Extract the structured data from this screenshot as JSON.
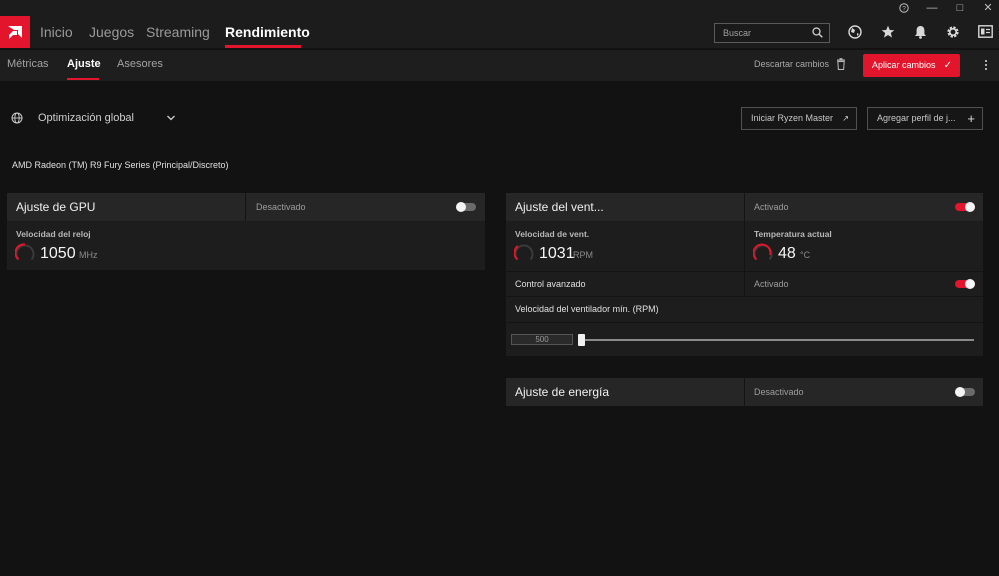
{
  "window": {
    "help_glyph": "?",
    "minimize_glyph": "—",
    "maximize_glyph": "□",
    "close_glyph": "✕"
  },
  "nav": {
    "items": [
      {
        "label": "Inicio"
      },
      {
        "label": "Juegos"
      },
      {
        "label": "Streaming"
      },
      {
        "label": "Rendimiento"
      }
    ],
    "active_index": 3
  },
  "search": {
    "placeholder": "Buscar"
  },
  "top_icons": [
    "globe-icon",
    "star-icon",
    "bell-icon",
    "gear-icon",
    "layout-icon"
  ],
  "subnav": {
    "items": [
      {
        "label": "Métricas"
      },
      {
        "label": "Ajuste"
      },
      {
        "label": "Asesores"
      }
    ],
    "active_index": 1
  },
  "actions": {
    "discard_label": "Descartar cambios",
    "apply_label": "Aplicar cambios"
  },
  "profile": {
    "selected": "Optimización global",
    "ryzen_master_label": "Iniciar Ryzen Master",
    "add_profile_label": "Agregar perfil de j..."
  },
  "device": {
    "name": "AMD Radeon (TM) R9 Fury Series (Principal/Discreto)"
  },
  "gpu_tuning": {
    "title": "Ajuste de GPU",
    "state": "Desactivado",
    "enabled": false,
    "clock_label": "Velocidad del reloj",
    "clock_value": "1050",
    "clock_unit": "MHz"
  },
  "fan_tuning": {
    "title": "Ajuste del vent...",
    "state": "Activado",
    "enabled": true,
    "fan_speed_label": "Velocidad de vent.",
    "fan_speed_value": "1031",
    "fan_speed_unit": "RPM",
    "temp_label": "Temperatura actual",
    "temp_value": "48",
    "temp_unit": "°C",
    "advanced_label": "Control avanzado",
    "advanced_state": "Activado",
    "advanced_enabled": true,
    "min_speed_label": "Velocidad del ventilador mín. (RPM)",
    "min_speed_value": "500",
    "min_speed_fraction": 0.0
  },
  "power_tuning": {
    "title": "Ajuste de energía",
    "state": "Desactivado",
    "enabled": false
  },
  "colors": {
    "accent": "#e2152c",
    "background": "#121212",
    "card": "#1d1d1d"
  }
}
